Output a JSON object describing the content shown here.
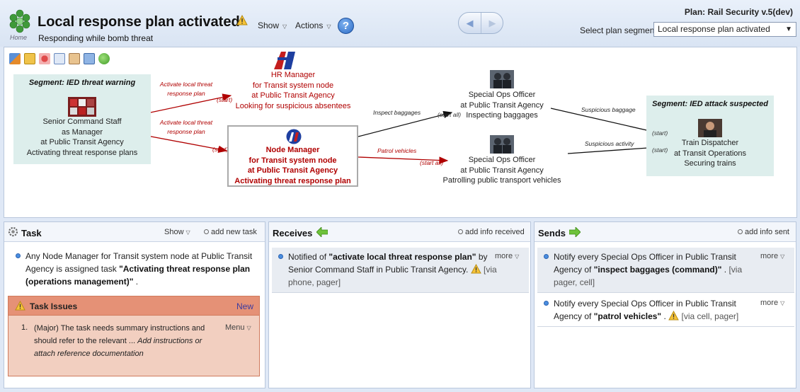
{
  "header": {
    "home_label": "Home",
    "title": "Local response plan activated",
    "subtitle": "Responding while bomb threat",
    "show_label": "Show",
    "actions_label": "Actions",
    "help_label": "?",
    "plan_title": "Plan: Rail Security v.5(dev)",
    "segment_label": "Select plan segment:",
    "segment_value": "Local response plan activated"
  },
  "diagram": {
    "seg_left": {
      "title": "Segment: IED threat warning",
      "node_lines": [
        "Senior Command Staff",
        "as Manager",
        "at Public Transit Agency",
        "Activating threat response plans"
      ]
    },
    "seg_right": {
      "title": "Segment: IED attack suspected",
      "node_lines": [
        "Train Dispatcher",
        "at Transit Operations",
        "Securing trains"
      ]
    },
    "hr_manager_lines": [
      "HR Manager",
      "for Transit system node",
      "at Public Transit Agency",
      "Looking for suspicious absentees"
    ],
    "node_manager_lines": [
      "Node Manager",
      "for Transit system node",
      "at Public Transit Agency",
      "Activating threat response plan"
    ],
    "special_ops_1_lines": [
      "Special Ops Officer",
      "at Public Transit Agency",
      "Inspecting baggages"
    ],
    "special_ops_2_lines": [
      "Special Ops Officer",
      "at Public Transit Agency",
      "Patrolling public transport vehicles"
    ],
    "flows": {
      "activate_1": [
        "Activate local threat",
        "response plan"
      ],
      "activate_2": [
        "Activate local threat",
        "response plan"
      ],
      "inspect_baggages": "Inspect baggages",
      "patrol_vehicles": "Patrol vehicles",
      "suspicious_baggage": "Suspicious baggage",
      "suspicious_activity": "Suspicious activity"
    },
    "start_labels": {
      "s1": "(start)",
      "s2": "(start)",
      "s3": "(start all)",
      "s4": "(start all)",
      "s5": "(start)",
      "s6": "(start)"
    }
  },
  "task_panel": {
    "title": "Task",
    "show_label": "Show",
    "add_label": "add new task",
    "item": {
      "prefix": "Any Node Manager for Transit system node at Public Transit Agency is assigned task ",
      "task_name": "\"Activating threat response plan (operations management)\"",
      "suffix": " ."
    },
    "issues": {
      "title": "Task Issues",
      "new_label": "New",
      "menu_label": "Menu",
      "number": "1.",
      "text": "(Major) The task needs summary instructions and should refer to the relevant ...",
      "hint": "Add instructions or attach reference documentation"
    }
  },
  "receives_panel": {
    "title": "Receives",
    "add_label": "add info received",
    "items": [
      {
        "prefix": "Notified of ",
        "info": "\"activate local threat response plan\"",
        "suffix": " by Senior Command Staff in Public Transit Agency.",
        "via": "[via phone, pager]",
        "more": "more"
      }
    ]
  },
  "sends_panel": {
    "title": "Sends",
    "add_label": "add info sent",
    "items": [
      {
        "prefix": "Notify every Special Ops Officer in Public Transit Agency of ",
        "info": "\"inspect baggages (command)\"",
        "suffix": " .",
        "via": "[via pager, cell]",
        "more": "more"
      },
      {
        "prefix": "Notify every Special Ops Officer in Public Transit Agency of ",
        "info": "\"patrol vehicles\"",
        "suffix": " .",
        "via": "[via cell, pager]",
        "more": "more"
      }
    ]
  },
  "colors": {
    "flow_red": "#b00000",
    "segment_bg": "#ddeeec",
    "issues_header": "#e59176",
    "issues_body": "#f2cfc0",
    "accent_blue": "#2c6cc6"
  }
}
